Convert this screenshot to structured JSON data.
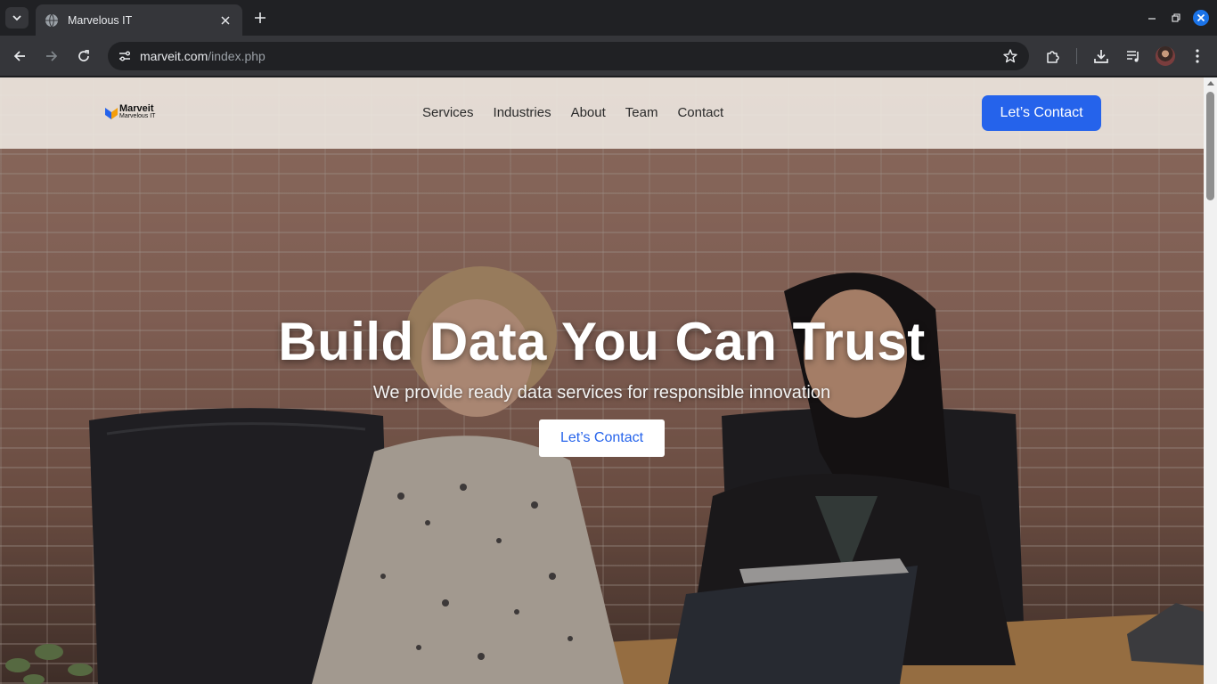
{
  "browser": {
    "tab": {
      "title": "Marvelous IT"
    },
    "address": {
      "domain": "marveit.com",
      "path": "/index.php"
    }
  },
  "site": {
    "logo": {
      "name": "Marveit",
      "tagline": "Marvelous IT"
    },
    "nav": [
      "Services",
      "Industries",
      "About",
      "Team",
      "Contact"
    ],
    "header_cta": "Let’s Contact",
    "hero": {
      "title": "Build Data You Can Trust",
      "subtitle": "We provide ready data services for responsible innovation",
      "cta": "Let’s Contact"
    }
  },
  "colors": {
    "accent": "#2563eb",
    "chrome_dark": "#202124",
    "chrome_toolbar": "#35363a",
    "close_button": "#1a73e8"
  },
  "icons": [
    "tab-search-icon",
    "globe-icon",
    "close-icon",
    "plus-icon",
    "minimize-icon",
    "restore-icon",
    "back-icon",
    "forward-icon",
    "reload-icon",
    "tune-icon",
    "star-icon",
    "extensions-icon",
    "download-icon",
    "media-icon",
    "menu-icon"
  ]
}
